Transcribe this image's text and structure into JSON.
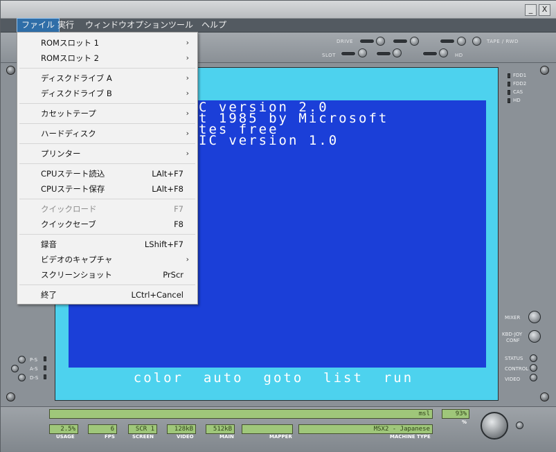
{
  "menubar": {
    "items": [
      "ファイル",
      "実行",
      "ウィンドウ",
      "オプション",
      "ツール",
      "ヘルプ"
    ],
    "active": "ファイル"
  },
  "window_controls": {
    "minimize": "_",
    "close": "X"
  },
  "top_panel": {
    "drive_label": "DRIVE",
    "slot_label": "SLOT",
    "tape_label": "TAPE / RWD",
    "hd_label": "HD"
  },
  "screen": {
    "lines": [
      "C version 2.0",
      "t 1985 by Microsoft",
      "tes free",
      "IC version 1.0"
    ],
    "function_keys": [
      "color",
      "auto",
      "goto",
      "list",
      "run"
    ],
    "border_color": "#4dd2ee",
    "background_color": "#1b3fd8"
  },
  "leds_right": [
    "FDD1",
    "FDD2",
    "CAS",
    "HD"
  ],
  "right_controls": {
    "mixer": "MIXER",
    "kbd_joy": "KBD-JOY",
    "conf": "CONF",
    "status": "STATUS",
    "control": "CONTROL",
    "video": "VIDEO"
  },
  "left_indicators": [
    "P-S",
    "A-S",
    "D-S"
  ],
  "file_menu": {
    "items": [
      {
        "label": "ROMスロット 1",
        "shortcut": "",
        "submenu": true,
        "disabled": false
      },
      {
        "label": "ROMスロット 2",
        "shortcut": "",
        "submenu": true,
        "disabled": false
      },
      {
        "label": "ディスクドライブ A",
        "shortcut": "",
        "submenu": true,
        "disabled": false
      },
      {
        "label": "ディスクドライブ B",
        "shortcut": "",
        "submenu": true,
        "disabled": false
      },
      {
        "label": "カセットテープ",
        "shortcut": "",
        "submenu": true,
        "disabled": false
      },
      {
        "label": "ハードディスク",
        "shortcut": "",
        "submenu": true,
        "disabled": false
      },
      {
        "label": "プリンター",
        "shortcut": "",
        "submenu": true,
        "disabled": false
      },
      {
        "label": "CPUステート読込",
        "shortcut": "LAlt+F7",
        "submenu": false,
        "disabled": false
      },
      {
        "label": "CPUステート保存",
        "shortcut": "LAlt+F8",
        "submenu": false,
        "disabled": false
      },
      {
        "label": "クイックロード",
        "shortcut": "F7",
        "submenu": false,
        "disabled": true
      },
      {
        "label": "クイックセーブ",
        "shortcut": "F8",
        "submenu": false,
        "disabled": false
      },
      {
        "label": "録音",
        "shortcut": "LShift+F7",
        "submenu": false,
        "disabled": false
      },
      {
        "label": "ビデオのキャプチャ",
        "shortcut": "",
        "submenu": true,
        "disabled": false
      },
      {
        "label": "スクリーンショット",
        "shortcut": "PrScr",
        "submenu": false,
        "disabled": false
      },
      {
        "label": "終了",
        "shortcut": "LCtrl+Cancel",
        "submenu": false,
        "disabled": false
      }
    ]
  },
  "status_bar": {
    "top_lcd": "msl",
    "percent_lcd": "93%",
    "percent_label": "%",
    "usage": {
      "value": "2.5%",
      "label": "USAGE"
    },
    "fps": {
      "value": "6",
      "label": "FPS"
    },
    "screen": {
      "value": "SCR 1",
      "label": "SCREEN"
    },
    "video": {
      "value": "128kB",
      "label": "VIDEO"
    },
    "main": {
      "value": "512kB",
      "label": "MAIN"
    },
    "mapper": {
      "value": "",
      "label": "MAPPER"
    },
    "machine": {
      "value": "MSX2 - Japanese",
      "label": "MACHINE TYPE"
    }
  }
}
